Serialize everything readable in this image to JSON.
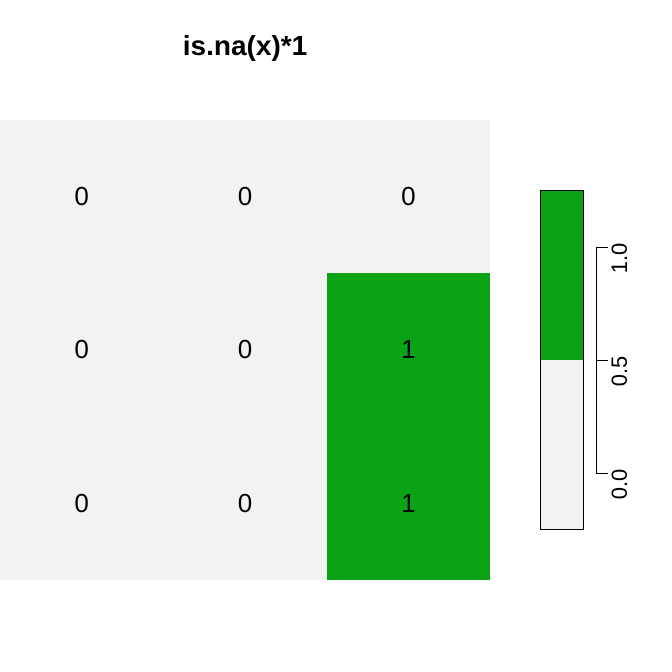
{
  "chart_data": {
    "type": "heatmap",
    "title": "is.na(x)*1",
    "nrows": 3,
    "ncols": 3,
    "values": [
      [
        0,
        0,
        0
      ],
      [
        0,
        0,
        1
      ],
      [
        0,
        0,
        1
      ]
    ],
    "colors": {
      "0": "#f2f2f2",
      "1": "#0aa315"
    },
    "legend": {
      "range": [
        -0.25,
        1.25
      ],
      "break": 0.5,
      "ticks": [
        0.0,
        0.5,
        1.0
      ],
      "tick_labels": [
        "0.0",
        "0.5",
        "1.0"
      ],
      "high_color": "#0aa315",
      "low_color": "#f2f2f2"
    }
  }
}
